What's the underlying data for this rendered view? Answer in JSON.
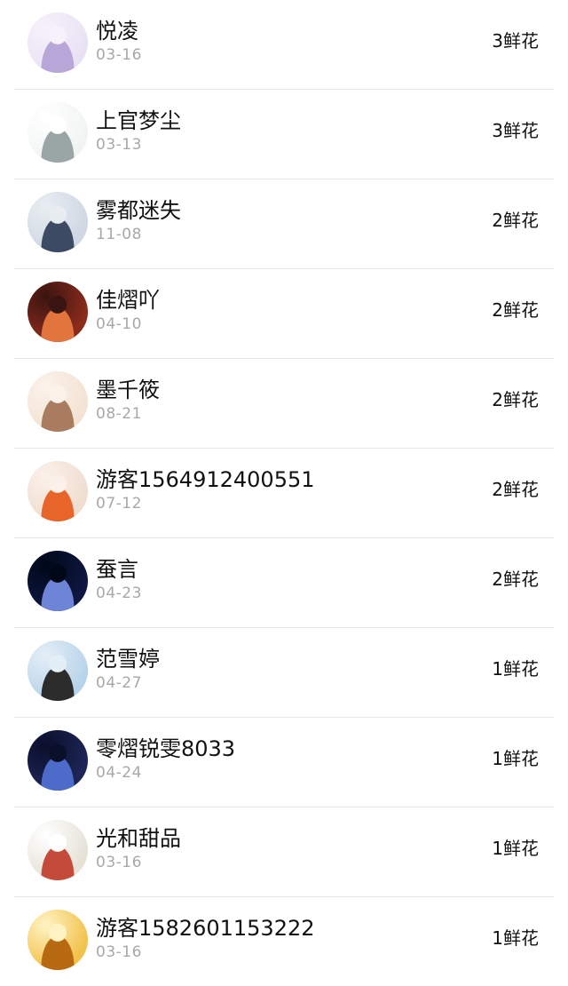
{
  "rows": [
    {
      "name": "悦凌",
      "date": "03-16",
      "flowers": "3鲜花",
      "avatar_colors": [
        "#e9e2f4",
        "#b9a6d9",
        "#f6f2fb"
      ],
      "avatar_icon": "avatar-purple-anime-icon"
    },
    {
      "name": "上官梦尘",
      "date": "03-13",
      "flowers": "3鲜花",
      "avatar_colors": [
        "#f2f4f4",
        "#9aa6a6",
        "#ffffff"
      ],
      "avatar_icon": "avatar-white-anime-icon"
    },
    {
      "name": "雾都迷失",
      "date": "11-08",
      "flowers": "2鲜花",
      "avatar_colors": [
        "#cfd8e3",
        "#3d4a63",
        "#e9edf2"
      ],
      "avatar_icon": "avatar-boy-anime-icon"
    },
    {
      "name": "佳熠吖",
      "date": "04-10",
      "flowers": "2鲜花",
      "avatar_colors": [
        "#8a2b1c",
        "#e2743e",
        "#3a1410"
      ],
      "avatar_icon": "avatar-red-anime-icon"
    },
    {
      "name": "墨千筱",
      "date": "08-21",
      "flowers": "2鲜花",
      "avatar_colors": [
        "#f3e3d4",
        "#a97c60",
        "#fbf2ea"
      ],
      "avatar_icon": "avatar-chibi-girl-icon"
    },
    {
      "name": "游客1564912400551",
      "date": "07-12",
      "flowers": "2鲜花",
      "avatar_colors": [
        "#f0ddd1",
        "#e8652a",
        "#fbf1ea"
      ],
      "avatar_icon": "avatar-orange-anime-icon"
    },
    {
      "name": "蚕言",
      "date": "04-23",
      "flowers": "2鲜花",
      "avatar_colors": [
        "#0d1740",
        "#6e84d6",
        "#000818"
      ],
      "avatar_icon": "avatar-night-silhouette-icon"
    },
    {
      "name": "范雪婷",
      "date": "04-27",
      "flowers": "1鲜花",
      "avatar_colors": [
        "#b8d4ea",
        "#2c2c2c",
        "#e4eef6"
      ],
      "avatar_icon": "avatar-photo-girl-icon"
    },
    {
      "name": "零熠锐雯8033",
      "date": "04-24",
      "flowers": "1鲜花",
      "avatar_colors": [
        "#1c2556",
        "#4d6cc9",
        "#0a0f2a"
      ],
      "avatar_icon": "avatar-dark-anime-icon"
    },
    {
      "name": "光和甜品",
      "date": "03-16",
      "flowers": "1鲜花",
      "avatar_colors": [
        "#e6e2d8",
        "#c44a3a",
        "#ffffff"
      ],
      "avatar_icon": "avatar-cartoon-duo-icon"
    },
    {
      "name": "游客1582601153222",
      "date": "03-16",
      "flowers": "1鲜花",
      "avatar_colors": [
        "#f2c24d",
        "#b86a12",
        "#fff3c4"
      ],
      "avatar_icon": "avatar-sunflower-icon"
    }
  ]
}
